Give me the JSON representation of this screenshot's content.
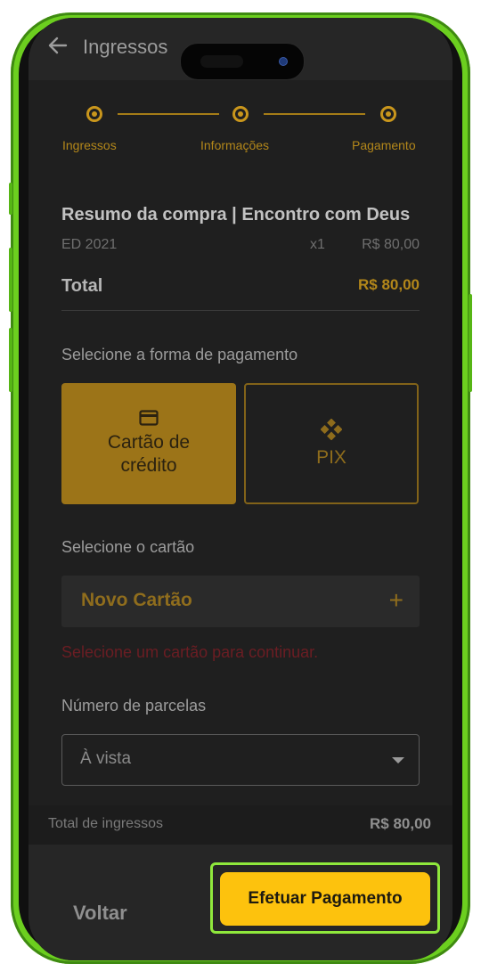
{
  "header": {
    "title": "Ingressos"
  },
  "stepper": {
    "steps": [
      {
        "label": "Ingressos"
      },
      {
        "label": "Informações"
      },
      {
        "label": "Pagamento"
      }
    ]
  },
  "summary": {
    "title": "Resumo da compra | Encontro com Deus",
    "item_name": "ED 2021",
    "quantity": "x1",
    "item_price": "R$ 80,00",
    "total_label": "Total",
    "total_value": "R$ 80,00"
  },
  "payment": {
    "section_label": "Selecione a forma de pagamento",
    "methods": [
      {
        "label": "Cartão de crédito",
        "icon": "credit-card-icon",
        "selected": true
      },
      {
        "label": "PIX",
        "icon": "pix-icon",
        "selected": false
      }
    ]
  },
  "card": {
    "section_label": "Selecione o cartão",
    "new_card_label": "Novo Cartão",
    "error": "Selecione um cartão para continuar."
  },
  "installments": {
    "section_label": "Número de parcelas",
    "selected": "À vista"
  },
  "footer": {
    "label": "Total de ingressos",
    "value": "R$ 80,00",
    "back_label": "Voltar",
    "submit_label": "Efetuar Pagamento"
  },
  "colors": {
    "accent": "#fdc20d",
    "accent_dim": "#b3871a",
    "error": "#6b1d23",
    "highlight": "#8fe83c"
  }
}
